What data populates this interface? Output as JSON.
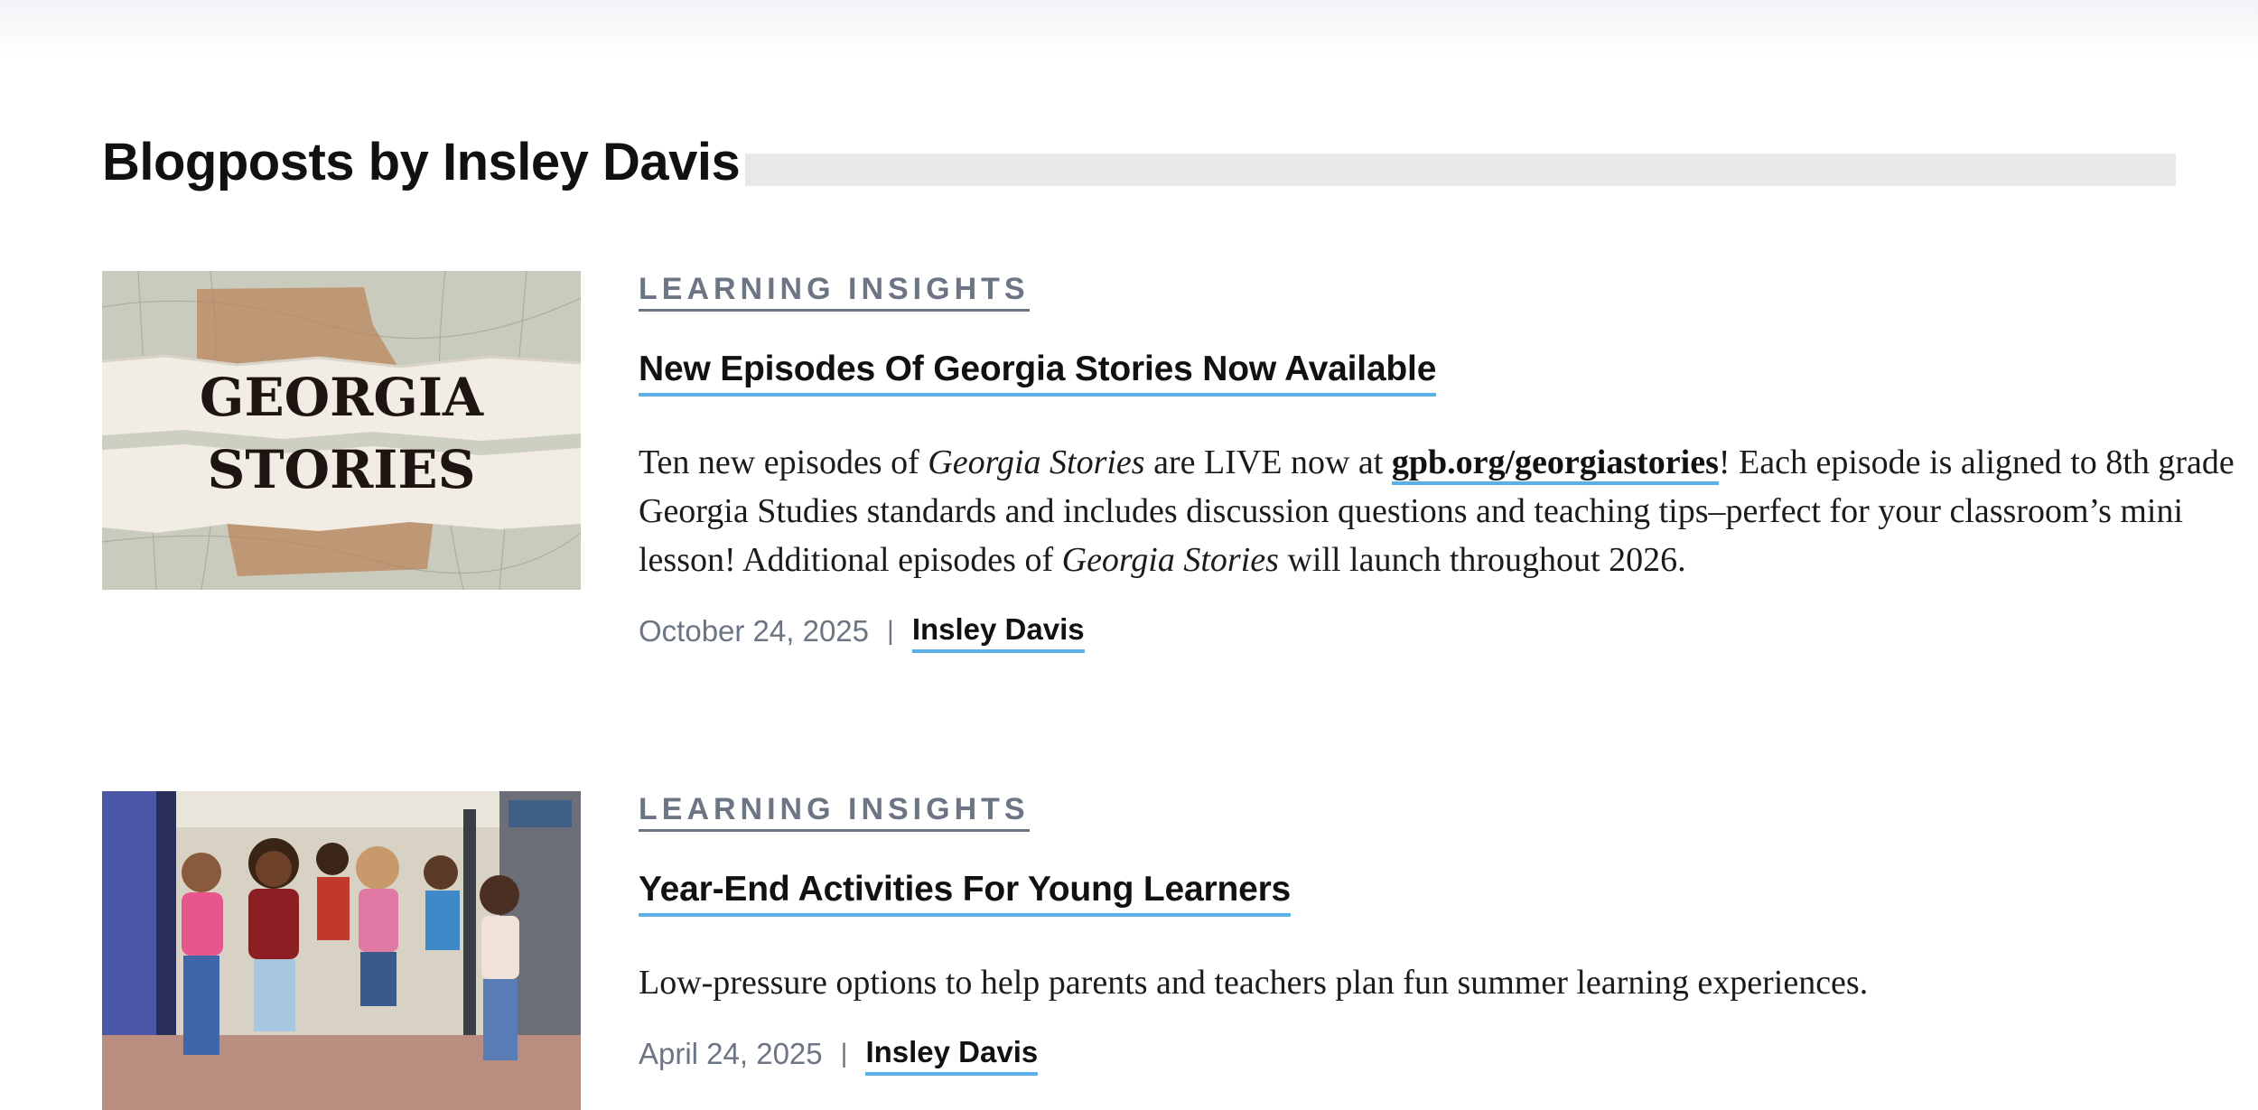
{
  "page": {
    "title": "Blogposts by Insley Davis"
  },
  "posts": [
    {
      "category": "LEARNING INSIGHTS",
      "title": "New Episodes Of Georgia Stories Now Available",
      "thumbnail_text": [
        "GEORGIA",
        "STORIES"
      ],
      "excerpt": {
        "p1": "Ten new episodes of ",
        "em1": "Georgia Stories",
        "p2": " are LIVE now at ",
        "link": "gpb.org/georgiastories",
        "p3": "! Each episode is aligned to 8th grade Georgia Studies standards and includes discussion questions and teaching tips–perfect for your classroom’s mini lesson! Additional episodes of ",
        "em2": "Georgia Stories",
        "p4": " will launch throughout 2026."
      },
      "date": "October 24, 2025",
      "separator": "|",
      "author": "Insley Davis"
    },
    {
      "category": "LEARNING INSIGHTS",
      "title": "Year-End Activities For Young Learners",
      "excerpt_text": "Low-pressure options to help parents and teachers plan fun summer learning experiences.",
      "date": "April 24, 2025",
      "separator": "|",
      "author": "Insley Davis"
    }
  ],
  "colors": {
    "accent_underline": "#5ab0e8",
    "category_gray": "#6c7583",
    "heading_bar": "#e8e9eb"
  }
}
